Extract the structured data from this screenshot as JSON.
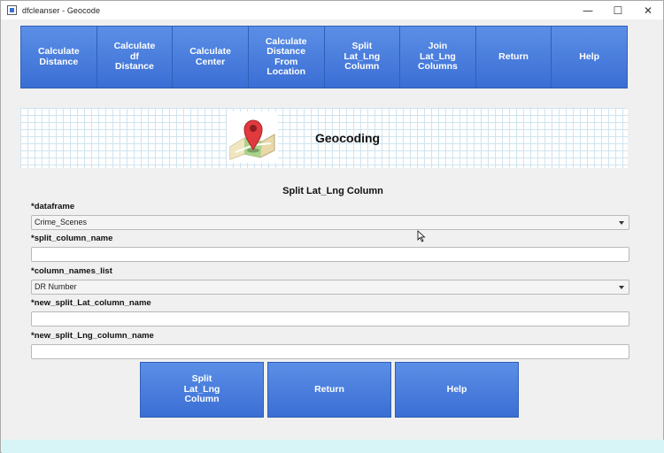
{
  "window": {
    "title": "dfcleanser - Geocode",
    "controls": {
      "minimize": "—",
      "maximize": "☐",
      "close": "✕"
    }
  },
  "toolbar": {
    "buttons": [
      {
        "label": "Calculate\nDistance"
      },
      {
        "label": "Calculate\ndf\nDistance"
      },
      {
        "label": "Calculate\nCenter"
      },
      {
        "label": "Calculate\nDistance\nFrom\nLocation"
      },
      {
        "label": "Split\nLat_Lng\nColumn"
      },
      {
        "label": "Join\nLat_Lng\nColumns"
      },
      {
        "label": "Return"
      },
      {
        "label": "Help"
      }
    ]
  },
  "banner": {
    "title": "Geocoding",
    "icon": "map-pin-icon"
  },
  "form": {
    "title": "Split Lat_Lng Column",
    "fields": [
      {
        "label": "*dataframe",
        "value": "Crime_Scenes",
        "type": "select"
      },
      {
        "label": "*split_column_name",
        "value": "",
        "type": "text"
      },
      {
        "label": "*column_names_list",
        "value": "DR Number",
        "type": "select"
      },
      {
        "label": "*new_split_Lat_column_name",
        "value": "",
        "type": "text"
      },
      {
        "label": "*new_split_Lng_column_name",
        "value": "",
        "type": "text"
      }
    ]
  },
  "actions": {
    "split_label": "Split\nLat_Lng\nColumn",
    "return_label": "Return",
    "help_label": "Help"
  },
  "colors": {
    "button_top": "#5b8fe6",
    "button_bottom": "#3b6ed4",
    "grid_line": "#cfe4ef",
    "pin_red": "#e03a3e"
  }
}
